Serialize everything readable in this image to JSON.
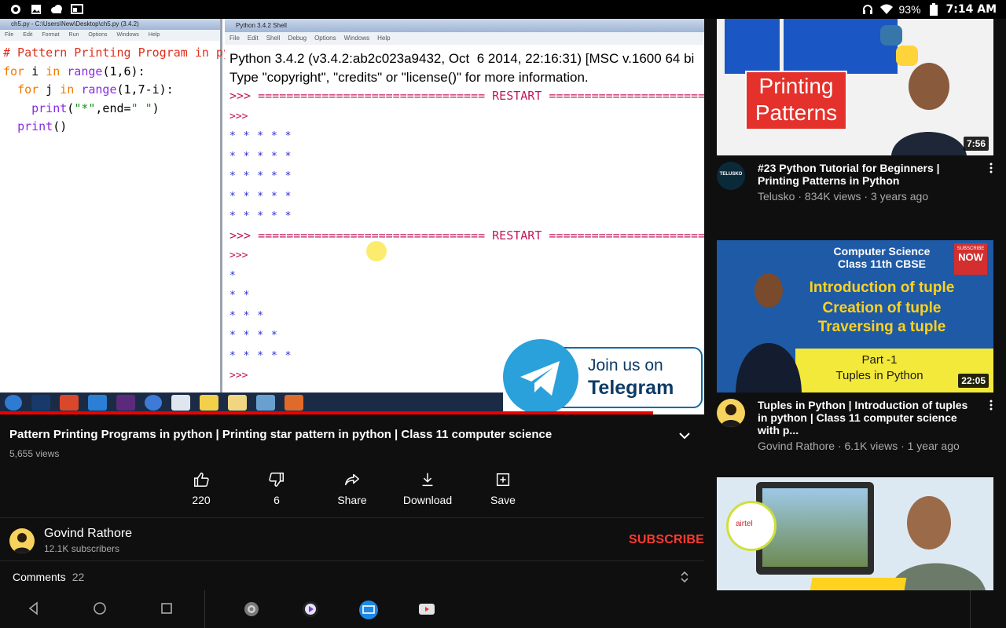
{
  "status_bar": {
    "left_icons": [
      "app-icon",
      "gallery-icon",
      "cloud-icon",
      "cast-icon"
    ],
    "battery": "93%",
    "time": "7:14 AM"
  },
  "video": {
    "idle_window_title": "ch5.py - C:\\Users\\New\\Desktop\\ch5.py (3.4.2)",
    "idle_menu": [
      "File",
      "Edit",
      "Format",
      "Run",
      "Options",
      "Windows",
      "Help"
    ],
    "code": {
      "line1": "# Pattern Printing Program in pytho",
      "line2_kw": "for",
      "line2_rest": " i ",
      "line2_in": "in",
      "line2_range": " range",
      "line2_args": "(1,6):",
      "line3_kw": "for",
      "line3_rest": " j ",
      "line3_in": "in",
      "line3_range": " range",
      "line3_args": "(1,7-i):",
      "line4_print": "print",
      "line4_open": "(",
      "line4_str1": "\"*\"",
      "line4_mid": ",end=",
      "line4_str2": "\" \"",
      "line4_close": ")",
      "line5_print": "print",
      "line5_args": "()"
    },
    "shell_title": "Python 3.4.2 Shell",
    "shell_menu": [
      "File",
      "Edit",
      "Shell",
      "Debug",
      "Options",
      "Windows",
      "Help"
    ],
    "shell_line1": "Python 3.4.2 (v3.4.2:ab2c023a9432, Oct  6 2014, 22:16:31) [MSC v.1600 64 bi",
    "shell_line2": "Type \"copyright\", \"credits\" or \"license()\" for more information.",
    "restart_line": ">>> ================================ RESTART ========================",
    "prompt": ">>>",
    "block1": [
      "* * * * *",
      "* * * * *",
      "* * * * *",
      "* * * * *",
      "* * * * *"
    ],
    "block2": [
      "*",
      "* *",
      "* * *",
      "* * * *",
      "* * * * *"
    ],
    "telegram_line1": "Join us on",
    "telegram_line2": "Telegram",
    "progress_fraction": 0.927
  },
  "title": "Pattern Printing Programs in python | Printing star pattern in python | Class 11 computer science",
  "views": "5,655 views",
  "actions": [
    {
      "icon": "like-icon",
      "label": "220"
    },
    {
      "icon": "dislike-icon",
      "label": "6"
    },
    {
      "icon": "share-icon",
      "label": "Share"
    },
    {
      "icon": "download-icon",
      "label": "Download"
    },
    {
      "icon": "save-icon",
      "label": "Save"
    }
  ],
  "channel": {
    "name": "Govind Rathore",
    "subscribers": "12.1K subscribers",
    "subscribe_label": "SUBSCRIBE"
  },
  "comments": {
    "label": "Comments",
    "count": "22"
  },
  "recommendations": [
    {
      "thumb_text_1": "Printing",
      "thumb_text_2": "Patterns",
      "duration": "7:56",
      "title": "#23 Python Tutorial for Beginners | Printing Patterns in Python",
      "meta": "Telusko · 834K views · 3 years ago",
      "avatar_text": "TELUSKO"
    },
    {
      "thumb_head_1": "Computer Science",
      "thumb_head_2": "Class 11th CBSE",
      "thumb_badge_1": "SUBSCRIBE",
      "thumb_badge_2": "NOW",
      "thumb_topics": [
        "Introduction of tuple",
        "Creation of tuple",
        "Traversing a tuple"
      ],
      "thumb_part": "Part -1",
      "thumb_part_sub": "Tuples in Python",
      "duration": "22:05",
      "title": "Tuples in Python | Introduction of tuples in python | Class 11 computer science with p...",
      "meta": "Govind Rathore · 6.1K views · 1 year ago"
    },
    {
      "thumb_logo": "airtel"
    }
  ],
  "colors": {
    "background": "#0f0f0f",
    "subscribe": "#ff3b30",
    "progress": "#ee0000",
    "telegram": "#2aa1da"
  }
}
